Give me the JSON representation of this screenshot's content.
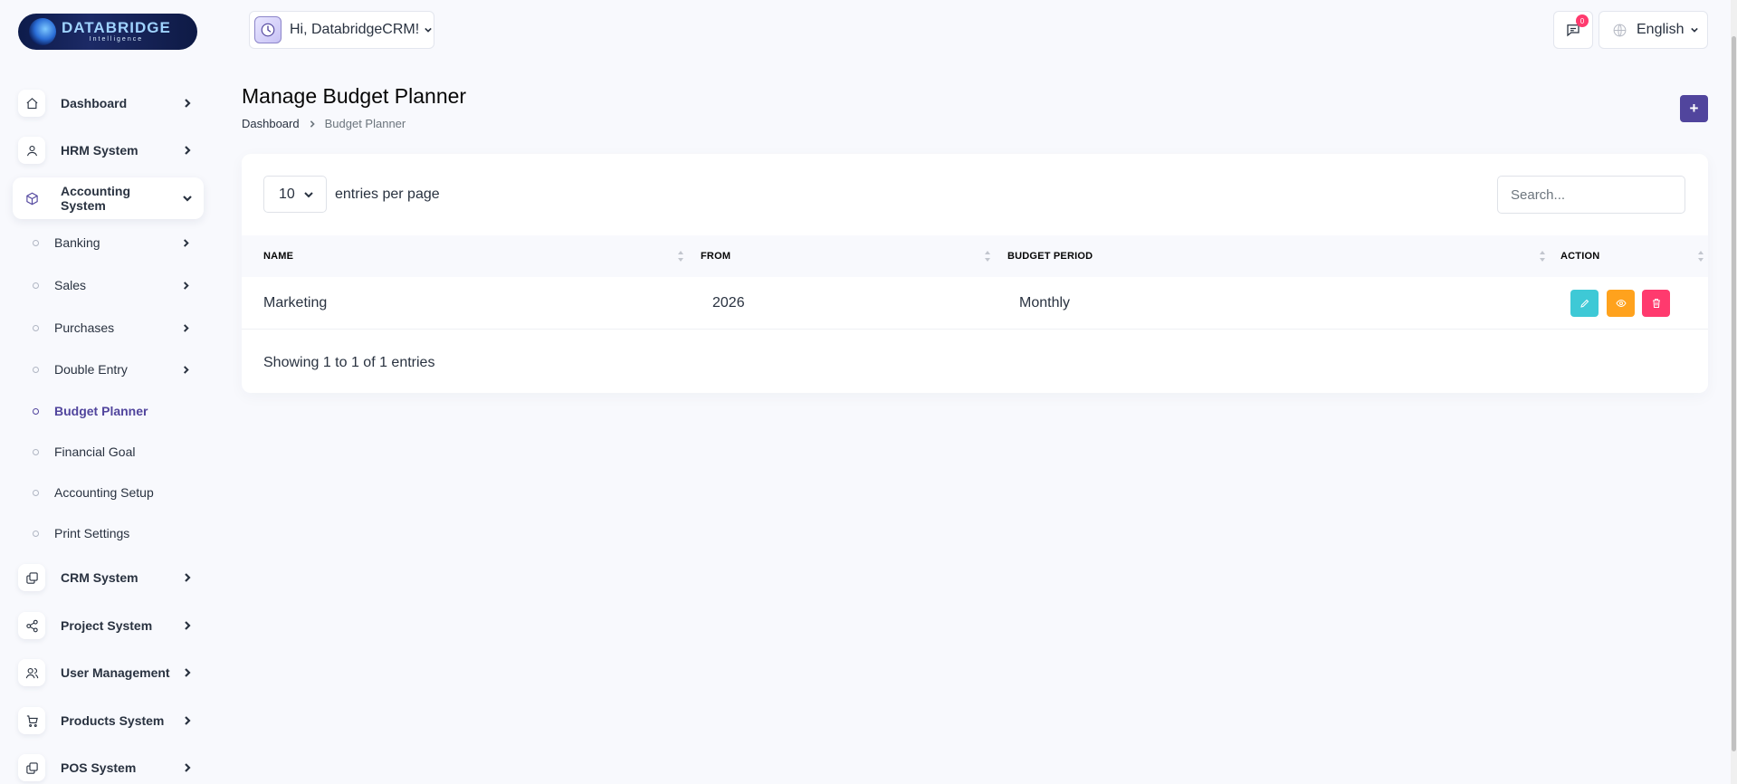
{
  "brand": {
    "title": "DATABRIDGE",
    "subtitle": "Intelligence"
  },
  "header": {
    "greeting": "Hi, DatabridgeCRM!",
    "notification_count": "0",
    "language": "English"
  },
  "sidebar": {
    "items": [
      {
        "label": "Dashboard",
        "icon": "home-icon"
      },
      {
        "label": "HRM System",
        "icon": "user-icon"
      },
      {
        "label": "Accounting System",
        "icon": "box-icon",
        "active": true
      }
    ],
    "accounting_sub": [
      {
        "label": "Banking"
      },
      {
        "label": "Sales"
      },
      {
        "label": "Purchases"
      },
      {
        "label": "Double Entry"
      },
      {
        "label": "Budget Planner",
        "active": true
      },
      {
        "label": "Financial Goal"
      },
      {
        "label": "Accounting Setup"
      },
      {
        "label": "Print Settings"
      }
    ],
    "items_after": [
      {
        "label": "CRM System",
        "icon": "layers-icon"
      },
      {
        "label": "Project System",
        "icon": "share-icon"
      },
      {
        "label": "User Management",
        "icon": "users-icon"
      },
      {
        "label": "Products System",
        "icon": "cart-icon"
      },
      {
        "label": "POS System",
        "icon": "layers-icon"
      }
    ]
  },
  "page": {
    "title": "Manage Budget Planner",
    "breadcrumb": {
      "home": "Dashboard",
      "current": "Budget Planner"
    },
    "add_label": "+"
  },
  "table": {
    "per_page": "10",
    "per_page_label": "entries per page",
    "search_placeholder": "Search...",
    "columns": [
      "NAME",
      "FROM",
      "BUDGET PERIOD",
      "ACTION"
    ],
    "rows": [
      {
        "name": "Marketing",
        "from": "2026",
        "period": "Monthly"
      }
    ],
    "footer": "Showing 1 to 1 of 1 entries"
  },
  "colors": {
    "primary": "#51459d",
    "edit": "#3ec9d6",
    "view": "#ffa21d",
    "delete": "#ff3a6e"
  }
}
